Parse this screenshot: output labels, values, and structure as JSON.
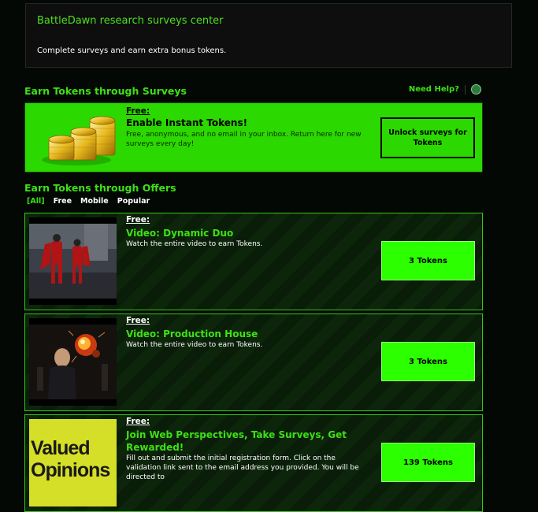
{
  "header": {
    "title": "BattleDawn research surveys center",
    "subtitle": "Complete surveys and earn extra bonus tokens."
  },
  "surveys": {
    "section_title": "Earn Tokens through Surveys",
    "help_link": "Need Help?",
    "help_separator": "|",
    "globe_icon": "globe-icon",
    "card": {
      "free_label": "Free:",
      "title": "Enable Instant Tokens!",
      "description": "Free, anonymous, and no email in your inbox. Return here for new surveys every day!",
      "button": "Unlock surveys for Tokens",
      "image_icon": "gold-coins-icon"
    }
  },
  "offers": {
    "section_title": "Earn Tokens through Offers",
    "filters": [
      "[All]",
      "Free",
      "Mobile",
      "Popular"
    ],
    "active_filter": "[All]",
    "items": [
      {
        "free_label": "Free:",
        "title": "Video: Dynamic Duo",
        "description": "Watch the entire video to earn Tokens.",
        "button": "3 Tokens"
      },
      {
        "free_label": "Free:",
        "title": "Video: Production House",
        "description": "Watch the entire video to earn Tokens.",
        "button": "3 Tokens"
      },
      {
        "free_label": "Free:",
        "title": "Join Web Perspectives, Take Surveys, Get Rewarded!",
        "description": "Fill out and submit the initial registration form. Click on the validation link sent to the email address you provided. You will be directed to",
        "button": "139 Tokens",
        "logo_text": [
          "Valued",
          "Opinions"
        ]
      }
    ]
  },
  "colors": {
    "accent": "#3ee015",
    "survey_bg": "#2bd800",
    "offer_button": "#2bff00",
    "page_bg": "#030805"
  }
}
